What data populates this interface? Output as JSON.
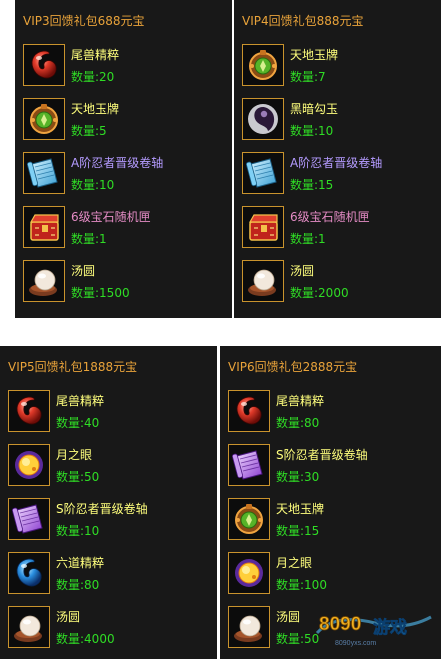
{
  "colors": {
    "panel_bg": "#181818",
    "title": "#e9a33a",
    "item_name": "#ffff7d",
    "item_name_purple": "#b49bff",
    "item_name_rose": "#e38bc4",
    "quantity": "#2fdc25",
    "icon_border": "#c9932d"
  },
  "panels": [
    {
      "title": "VIP3回馈礼包688元宝",
      "items": [
        {
          "icon": "beast-essence-icon",
          "name": "尾兽精粹",
          "qty": "数量:20"
        },
        {
          "icon": "heaven-earth-jade-icon",
          "name": "天地玉牌",
          "qty": "数量:5"
        },
        {
          "icon": "scroll-a-icon",
          "name": "A阶忍者晋级卷轴",
          "qty": "数量:10"
        },
        {
          "icon": "gem-chest-icon",
          "name": "6级宝石随机匣",
          "qty": "数量:1"
        },
        {
          "icon": "tangyuan-icon",
          "name": "汤圆",
          "qty": "数量:1500"
        }
      ]
    },
    {
      "title": "VIP4回馈礼包888元宝",
      "items": [
        {
          "icon": "heaven-earth-jade-icon",
          "name": "天地玉牌",
          "qty": "数量:7"
        },
        {
          "icon": "dark-magatama-icon",
          "name": "黑暗勾玉",
          "qty": "数量:10"
        },
        {
          "icon": "scroll-a-icon",
          "name": "A阶忍者晋级卷轴",
          "qty": "数量:15"
        },
        {
          "icon": "gem-chest-icon",
          "name": "6级宝石随机匣",
          "qty": "数量:1"
        },
        {
          "icon": "tangyuan-icon",
          "name": "汤圆",
          "qty": "数量:2000"
        }
      ]
    },
    {
      "title": "VIP5回馈礼包1888元宝",
      "items": [
        {
          "icon": "beast-essence-icon",
          "name": "尾兽精粹",
          "qty": "数量:40"
        },
        {
          "icon": "moon-eye-icon",
          "name": "月之眼",
          "qty": "数量:50"
        },
        {
          "icon": "scroll-s-icon",
          "name": "S阶忍者晋级卷轴",
          "qty": "数量:10"
        },
        {
          "icon": "six-path-essence-icon",
          "name": "六道精粹",
          "qty": "数量:80"
        },
        {
          "icon": "tangyuan-icon",
          "name": "汤圆",
          "qty": "数量:4000"
        }
      ]
    },
    {
      "title": "VIP6回馈礼包2888元宝",
      "items": [
        {
          "icon": "beast-essence-icon",
          "name": "尾兽精粹",
          "qty": "数量:80"
        },
        {
          "icon": "scroll-s-icon",
          "name": "S阶忍者晋级卷轴",
          "qty": "数量:30"
        },
        {
          "icon": "heaven-earth-jade-icon",
          "name": "天地玉牌",
          "qty": "数量:15"
        },
        {
          "icon": "moon-eye-icon",
          "name": "月之眼",
          "qty": "数量:100"
        },
        {
          "icon": "tangyuan-icon",
          "name": "汤圆",
          "qty": "数量:50"
        }
      ]
    }
  ],
  "watermark": {
    "logo_text": "8090",
    "brand_text": "游戏",
    "url_text": "8090yxs.com"
  }
}
